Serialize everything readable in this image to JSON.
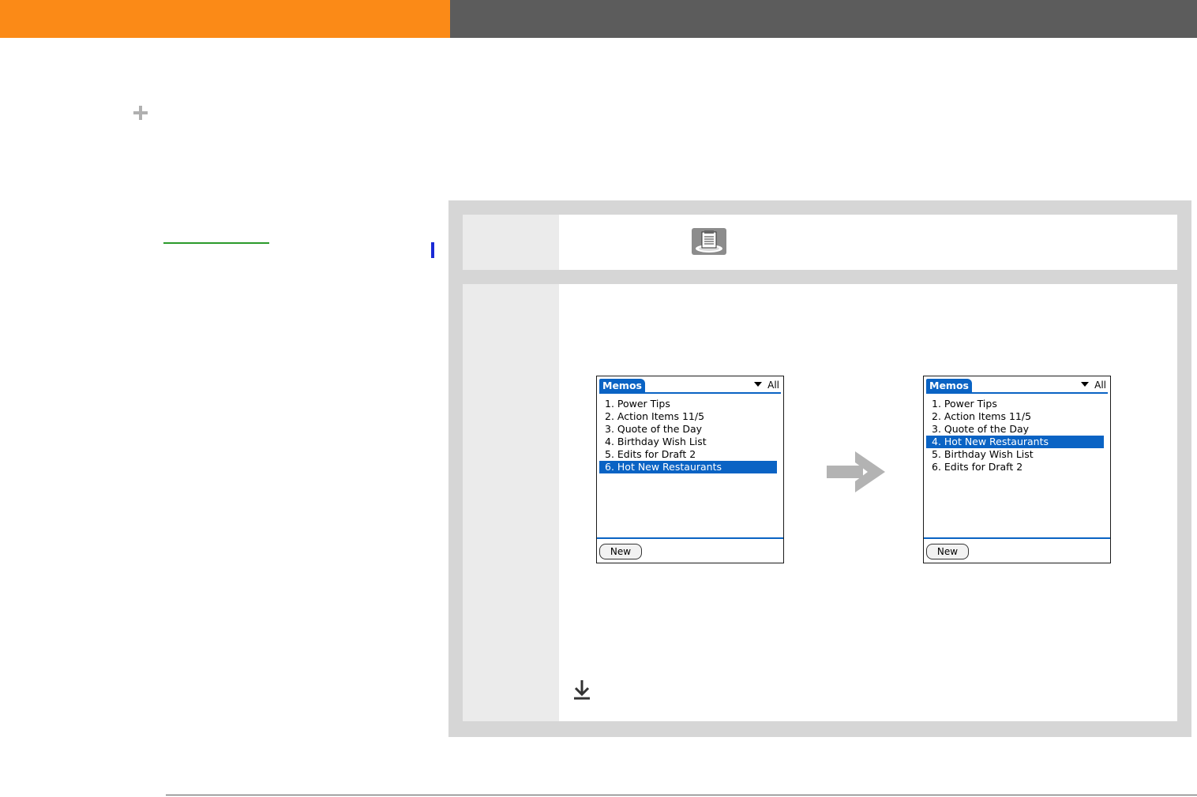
{
  "colors": {
    "header_orange": "#fb8a17",
    "header_gray": "#5c5c5c",
    "link_green": "#2b9a2b",
    "marker_blue": "#1a2ad6",
    "palm_blue": "#0a63c4",
    "arrow_gray": "#b3b3b3"
  },
  "icons": {
    "plus": "plus-icon",
    "memos_app": "memos-app-icon",
    "arrow": "arrow-right-icon",
    "download": "download-arrow-icon"
  },
  "screen_before": {
    "title": "Memos",
    "category": "All",
    "new_label": "New",
    "items": [
      "1.  Power Tips",
      "2.  Action Items 11/5",
      "3.  Quote of the Day",
      "4.  Birthday Wish List",
      "5.  Edits for Draft 2",
      "6.  Hot New Restaurants"
    ],
    "selected_index": 5
  },
  "screen_after": {
    "title": "Memos",
    "category": "All",
    "new_label": "New",
    "items": [
      "1.  Power Tips",
      "2.  Action Items 11/5",
      "3.  Quote of the Day",
      "4.  Hot New Restaurants",
      "5.  Birthday Wish List",
      "6.  Edits for Draft 2"
    ],
    "selected_index": 3
  }
}
